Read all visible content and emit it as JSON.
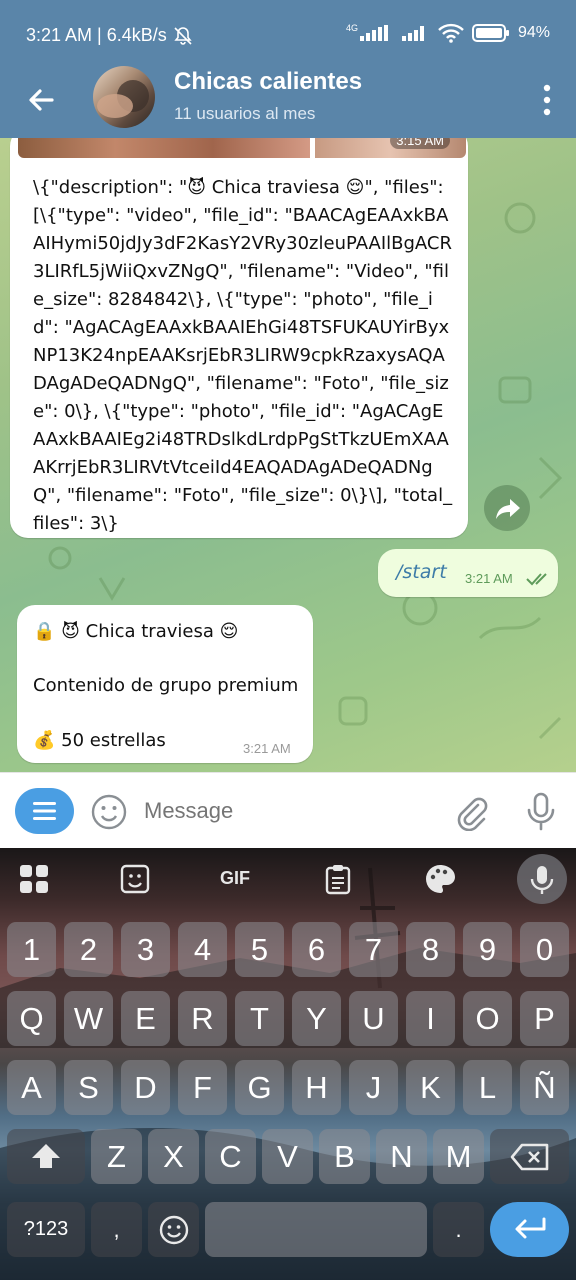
{
  "status_bar": {
    "time_speed": "3:21 AM | 6.4kB/s",
    "network_4g": "4G",
    "battery": "94%"
  },
  "header": {
    "title": "Chicas calientes",
    "subtitle": "11 usuarios al mes"
  },
  "messages": [
    {
      "media_time": "3:15 AM",
      "text": "\\{\"description\": \"😈 Chica traviesa 😌\", \"files\": [\\{\"type\": \"video\", \"file_id\": \"BAACAgEAAxkBAAIHymi50jdJy3dF2KasY2VRy30zleuPAAIlBgACR3LIRfL5jWiiQxvZNgQ\", \"filename\": \"Video\", \"file_size\": 8284842\\}, \\{\"type\": \"photo\", \"file_id\": \"AgACAgEAAxkBAAIEhGi48TSFUKAUYirByxNP13K24npEAAKsrjEbR3LIRW9cpkRzaxysAQADAgADeQADNgQ\", \"filename\": \"Foto\", \"file_size\": 0\\}, \\{\"type\": \"photo\", \"file_id\": \"AgACAgEAAxkBAAIEg2i48TRDslkdLrdpPgStTkzUEmXAAAKrrjEbR3LIRVtVtceiId4EAQADAgADeQADNgQ\", \"filename\": \"Foto\", \"file_size\": 0\\}\\], \"total_files\": 3\\}"
    },
    {
      "text": "/start",
      "time": "3:21 AM"
    },
    {
      "line1": "🔒 😈 Chica traviesa 😌",
      "line2": "Contenido de grupo premium",
      "line3": "💰 50 estrellas",
      "time": "3:21 AM"
    }
  ],
  "input": {
    "placeholder": "Message"
  },
  "keyboard": {
    "toolbar": [
      "grid",
      "sticker",
      "GIF",
      "clipboard",
      "palette",
      "mic"
    ],
    "row_numbers": [
      "1",
      "2",
      "3",
      "4",
      "5",
      "6",
      "7",
      "8",
      "9",
      "0"
    ],
    "row1": [
      "Q",
      "W",
      "E",
      "R",
      "T",
      "Y",
      "U",
      "I",
      "O",
      "P"
    ],
    "row2": [
      "A",
      "S",
      "D",
      "F",
      "G",
      "H",
      "J",
      "K",
      "L",
      "Ñ"
    ],
    "row3": [
      "Z",
      "X",
      "C",
      "V",
      "B",
      "N",
      "M"
    ],
    "sym_label": "?123",
    "comma": ",",
    "period": "."
  }
}
